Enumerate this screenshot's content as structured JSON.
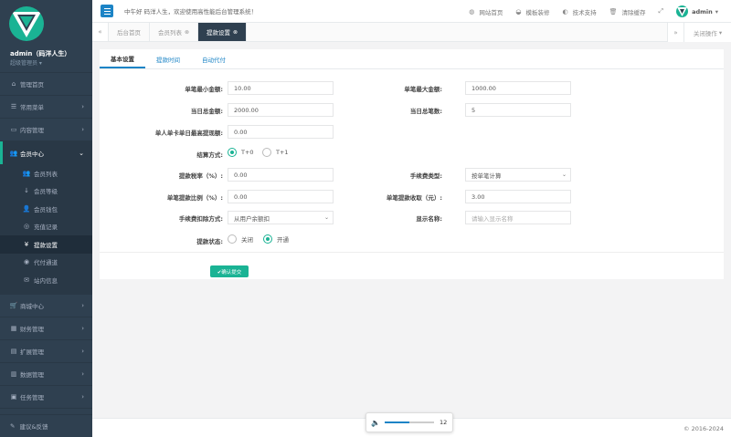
{
  "sidebar": {
    "user_name": "admin（码洋人生）",
    "user_role": "超级管理员",
    "menu": [
      {
        "label": "管理首页",
        "icon": "home-icon"
      },
      {
        "label": "常用菜单",
        "icon": "list-icon"
      },
      {
        "label": "内容管理",
        "icon": "monitor-icon"
      },
      {
        "label": "会员中心",
        "icon": "users-icon"
      }
    ],
    "member_sub": [
      {
        "label": "会员列表",
        "icon": "users-icon"
      },
      {
        "label": "会员等级",
        "icon": "sort-icon"
      },
      {
        "label": "会员钱包",
        "icon": "user-icon"
      },
      {
        "label": "充值记录",
        "icon": "record-icon"
      },
      {
        "label": "提款设置",
        "icon": "yen-icon"
      },
      {
        "label": "代付通道",
        "icon": "channel-icon"
      },
      {
        "label": "站内信息",
        "icon": "message-icon"
      }
    ],
    "menu_bottom": [
      {
        "label": "商城中心",
        "icon": "cart-icon"
      },
      {
        "label": "财务管理",
        "icon": "calculator-icon"
      },
      {
        "label": "扩展管理",
        "icon": "chart-icon"
      },
      {
        "label": "数据管理",
        "icon": "database-icon"
      },
      {
        "label": "任务管理",
        "icon": "tasks-icon"
      }
    ],
    "feedback": "建议&反馈"
  },
  "topbar": {
    "welcome": "中午好 码洋人生，欢迎使用高性能后台管理系统！",
    "links": [
      {
        "label": "网站首页",
        "icon": "globe-icon"
      },
      {
        "label": "模板装修",
        "icon": "palette-icon"
      },
      {
        "label": "技术支持",
        "icon": "support-icon"
      },
      {
        "label": "清除缓存",
        "icon": "trash-icon"
      }
    ],
    "admin": "admin"
  },
  "tabbar": {
    "tabs": [
      {
        "label": "后台首页",
        "closable": false
      },
      {
        "label": "会员列表",
        "closable": true
      },
      {
        "label": "提款设置",
        "closable": true,
        "active": true
      }
    ],
    "close_ops": "关闭操作"
  },
  "settings": {
    "tabs": [
      "基本设置",
      "提款时间",
      "自动代付"
    ],
    "fields": {
      "min_amount": {
        "label": "单笔最小金额:",
        "value": "10.00"
      },
      "max_amount": {
        "label": "单笔最大金额:",
        "value": "1000.00"
      },
      "daily_total": {
        "label": "当日总金额:",
        "value": "2000.00"
      },
      "daily_count": {
        "label": "当日总笔数:",
        "value": "5"
      },
      "per_card_max": {
        "label": "单人单卡单日最高提现额:",
        "value": "0.00"
      },
      "settle_mode": {
        "label": "结算方式:",
        "options": [
          "T+0",
          "T+1"
        ],
        "selected": "T+0"
      },
      "tax_rate": {
        "label": "提款税率（%）:",
        "value": "0.00"
      },
      "fee_type": {
        "label": "手续费类型:",
        "value": "按单笔计算"
      },
      "fee_ratio": {
        "label": "单笔提款比例（%）:",
        "value": "0.00"
      },
      "fee_fixed": {
        "label": "单笔提款收取（元）:",
        "value": "3.00"
      },
      "fee_deduct": {
        "label": "手续费扣除方式:",
        "value": "从用户余额扣"
      },
      "display_name": {
        "label": "显示名称:",
        "placeholder": "请输入显示名称"
      },
      "status": {
        "label": "提款状态:",
        "options": [
          "关闭",
          "开通"
        ],
        "selected": "开通"
      }
    },
    "submit": "✔确认提交"
  },
  "footer": {
    "copyright": "© 2016-2024"
  },
  "player": {
    "volume": 12,
    "level": 0.5
  }
}
